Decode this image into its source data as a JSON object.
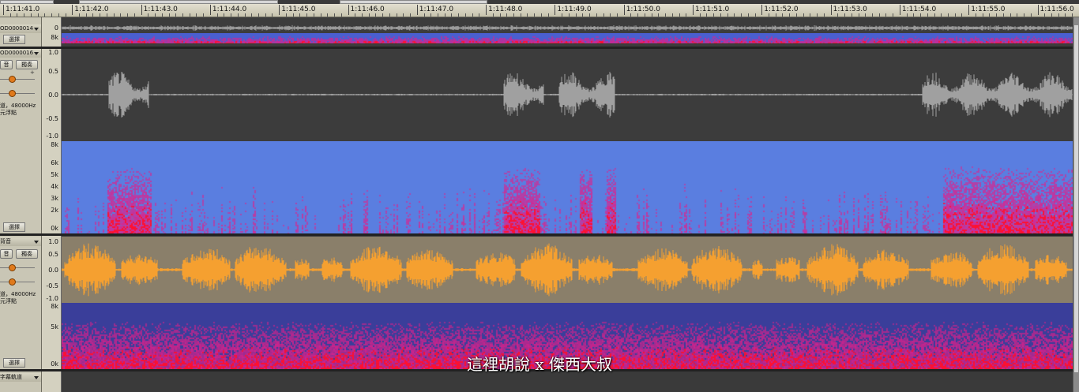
{
  "ruler": {
    "times": [
      "1:11:41.0",
      "1:11:42.0",
      "1:11:43.0",
      "1:11:44.0",
      "1:11:45.0",
      "1:11:46.0",
      "1:11:47.0",
      "1:11:48.0",
      "1:11:49.0",
      "1:11:50.0",
      "1:11:51.0",
      "1:11:52.0",
      "1:11:53.0",
      "1:11:54.0",
      "1:11:55.0",
      "1:11:56.0"
    ]
  },
  "tracks": [
    {
      "name": "OD0000014",
      "select_label": "選擇",
      "axis": {
        "wave_top": "0",
        "spec_top": "8k"
      },
      "waveform_color": "#9a9a9a",
      "background": "#3a3a3a"
    },
    {
      "name": "OD0000016",
      "mute_label": "音",
      "solo_label": "獨奏",
      "info_line1": "道，48000Hz",
      "info_line2": "元浮點",
      "select_label": "選擇",
      "axis": {
        "wave": [
          "1.0",
          "0.5",
          "0.0",
          "-0.5",
          "-1.0"
        ],
        "spec": [
          "8k",
          "6k",
          "5k",
          "4k",
          "3k",
          "2k",
          "0k"
        ]
      },
      "waveform_color": "#a0a0a0",
      "background": "#3c3c3c"
    },
    {
      "name": "背音",
      "mute_label": "音",
      "solo_label": "獨奏",
      "info_line1": "道，48000Hz",
      "info_line2": "元浮點",
      "select_label": "選擇",
      "axis": {
        "wave": [
          "1.0",
          "0.5",
          "0.0",
          "-0.5",
          "-1.0"
        ],
        "spec": [
          "8k",
          "5k",
          "0k"
        ]
      },
      "waveform_color": "#f5a030",
      "background": "#8a7f6a"
    },
    {
      "name": "字幕軌道"
    }
  ],
  "subtitle": "這裡胡說 x 傑西大叔",
  "colors": {
    "spec_low": "#5a7ee0",
    "spec_mid": "#e0208a",
    "spec_high": "#ff1030"
  }
}
